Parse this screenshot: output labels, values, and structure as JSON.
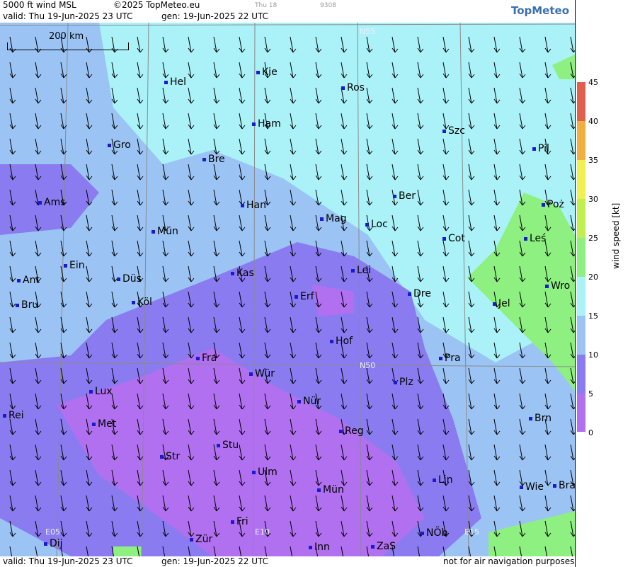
{
  "header": {
    "product": "5000 ft wind MSL",
    "copyright": "©2025 TopMeteo.eu",
    "day_small": "Thu 18",
    "code_small": "9308",
    "valid": "valid:  Thu  19-Jun-2025  23 UTC",
    "gen": "gen: 19-Jun-2025 22 UTC",
    "logo": "TopMeteo"
  },
  "footer": {
    "valid": "valid:  Thu  19-Jun-2025  23 UTC",
    "gen": "gen: 19-Jun-2025 22 UTC",
    "note": "not for air navigation purposes"
  },
  "scale_label": "200 km",
  "grid_labels": [
    "N55",
    "N50",
    "E05",
    "E10",
    "E15"
  ],
  "cities": [
    "Hel",
    "Kie",
    "Ros",
    "Ham",
    "Szc",
    "Gro",
    "Bre",
    "Pil",
    "Ber",
    "Ams",
    "Han",
    "Mag",
    "Loc",
    "Poż",
    "Mün",
    "Cot",
    "Leś",
    "Ein",
    "Kas",
    "Lei",
    "Ant",
    "Düs",
    "Dre",
    "Wro",
    "Erf",
    "Bru",
    "Köl",
    "Jel",
    "Hof",
    "Fra",
    "Pra",
    "Wür",
    "Plz",
    "Lux",
    "Nür",
    "Rei",
    "Met",
    "Reg",
    "Brn",
    "Stu",
    "Str",
    "Ulm",
    "Lin",
    "Wie",
    "Bra",
    "Mün",
    "Fri",
    "NÖb",
    "Zür",
    "Dij",
    "Inn",
    "ZaS"
  ],
  "legend": {
    "title": "wind speed  [kt]",
    "ticks": [
      "45",
      "40",
      "35",
      "30",
      "25",
      "20",
      "15",
      "10",
      "5",
      "0"
    ],
    "colors": [
      "#b070f0",
      "#8a7cf0",
      "#9bc4f5",
      "#aaf2f8",
      "#8df080",
      "#f0f050",
      "#f0b040",
      "#e06050"
    ]
  }
}
